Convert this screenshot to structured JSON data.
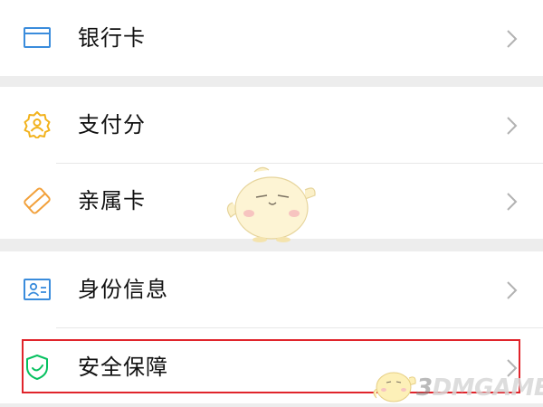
{
  "menu": {
    "items": [
      {
        "label": "银行卡",
        "icon": "bank-card-icon",
        "color": "#3a8cdc"
      },
      {
        "label": "支付分",
        "icon": "payment-score-icon",
        "color": "#f2b21c"
      },
      {
        "label": "亲属卡",
        "icon": "family-card-icon",
        "color": "#f2a03a"
      },
      {
        "label": "身份信息",
        "icon": "id-card-icon",
        "color": "#3a8cdc"
      },
      {
        "label": "安全保障",
        "icon": "security-shield-icon",
        "color": "#07c160"
      }
    ]
  },
  "highlight_color": "#e0242b",
  "watermark": {
    "prefix": "3",
    "suffix": "DMGAME"
  }
}
